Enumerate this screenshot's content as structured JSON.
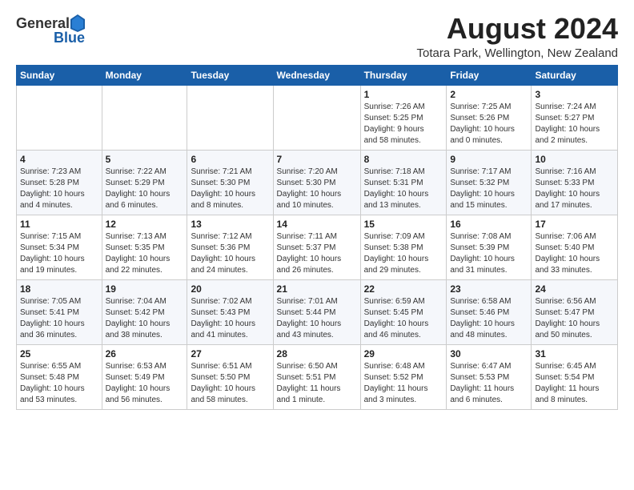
{
  "header": {
    "logo_general": "General",
    "logo_blue": "Blue",
    "month_title": "August 2024",
    "location": "Totara Park, Wellington, New Zealand"
  },
  "days_of_week": [
    "Sunday",
    "Monday",
    "Tuesday",
    "Wednesday",
    "Thursday",
    "Friday",
    "Saturday"
  ],
  "weeks": [
    [
      {
        "day": "",
        "info": ""
      },
      {
        "day": "",
        "info": ""
      },
      {
        "day": "",
        "info": ""
      },
      {
        "day": "",
        "info": ""
      },
      {
        "day": "1",
        "info": "Sunrise: 7:26 AM\nSunset: 5:25 PM\nDaylight: 9 hours\nand 58 minutes."
      },
      {
        "day": "2",
        "info": "Sunrise: 7:25 AM\nSunset: 5:26 PM\nDaylight: 10 hours\nand 0 minutes."
      },
      {
        "day": "3",
        "info": "Sunrise: 7:24 AM\nSunset: 5:27 PM\nDaylight: 10 hours\nand 2 minutes."
      }
    ],
    [
      {
        "day": "4",
        "info": "Sunrise: 7:23 AM\nSunset: 5:28 PM\nDaylight: 10 hours\nand 4 minutes."
      },
      {
        "day": "5",
        "info": "Sunrise: 7:22 AM\nSunset: 5:29 PM\nDaylight: 10 hours\nand 6 minutes."
      },
      {
        "day": "6",
        "info": "Sunrise: 7:21 AM\nSunset: 5:30 PM\nDaylight: 10 hours\nand 8 minutes."
      },
      {
        "day": "7",
        "info": "Sunrise: 7:20 AM\nSunset: 5:30 PM\nDaylight: 10 hours\nand 10 minutes."
      },
      {
        "day": "8",
        "info": "Sunrise: 7:18 AM\nSunset: 5:31 PM\nDaylight: 10 hours\nand 13 minutes."
      },
      {
        "day": "9",
        "info": "Sunrise: 7:17 AM\nSunset: 5:32 PM\nDaylight: 10 hours\nand 15 minutes."
      },
      {
        "day": "10",
        "info": "Sunrise: 7:16 AM\nSunset: 5:33 PM\nDaylight: 10 hours\nand 17 minutes."
      }
    ],
    [
      {
        "day": "11",
        "info": "Sunrise: 7:15 AM\nSunset: 5:34 PM\nDaylight: 10 hours\nand 19 minutes."
      },
      {
        "day": "12",
        "info": "Sunrise: 7:13 AM\nSunset: 5:35 PM\nDaylight: 10 hours\nand 22 minutes."
      },
      {
        "day": "13",
        "info": "Sunrise: 7:12 AM\nSunset: 5:36 PM\nDaylight: 10 hours\nand 24 minutes."
      },
      {
        "day": "14",
        "info": "Sunrise: 7:11 AM\nSunset: 5:37 PM\nDaylight: 10 hours\nand 26 minutes."
      },
      {
        "day": "15",
        "info": "Sunrise: 7:09 AM\nSunset: 5:38 PM\nDaylight: 10 hours\nand 29 minutes."
      },
      {
        "day": "16",
        "info": "Sunrise: 7:08 AM\nSunset: 5:39 PM\nDaylight: 10 hours\nand 31 minutes."
      },
      {
        "day": "17",
        "info": "Sunrise: 7:06 AM\nSunset: 5:40 PM\nDaylight: 10 hours\nand 33 minutes."
      }
    ],
    [
      {
        "day": "18",
        "info": "Sunrise: 7:05 AM\nSunset: 5:41 PM\nDaylight: 10 hours\nand 36 minutes."
      },
      {
        "day": "19",
        "info": "Sunrise: 7:04 AM\nSunset: 5:42 PM\nDaylight: 10 hours\nand 38 minutes."
      },
      {
        "day": "20",
        "info": "Sunrise: 7:02 AM\nSunset: 5:43 PM\nDaylight: 10 hours\nand 41 minutes."
      },
      {
        "day": "21",
        "info": "Sunrise: 7:01 AM\nSunset: 5:44 PM\nDaylight: 10 hours\nand 43 minutes."
      },
      {
        "day": "22",
        "info": "Sunrise: 6:59 AM\nSunset: 5:45 PM\nDaylight: 10 hours\nand 46 minutes."
      },
      {
        "day": "23",
        "info": "Sunrise: 6:58 AM\nSunset: 5:46 PM\nDaylight: 10 hours\nand 48 minutes."
      },
      {
        "day": "24",
        "info": "Sunrise: 6:56 AM\nSunset: 5:47 PM\nDaylight: 10 hours\nand 50 minutes."
      }
    ],
    [
      {
        "day": "25",
        "info": "Sunrise: 6:55 AM\nSunset: 5:48 PM\nDaylight: 10 hours\nand 53 minutes."
      },
      {
        "day": "26",
        "info": "Sunrise: 6:53 AM\nSunset: 5:49 PM\nDaylight: 10 hours\nand 56 minutes."
      },
      {
        "day": "27",
        "info": "Sunrise: 6:51 AM\nSunset: 5:50 PM\nDaylight: 10 hours\nand 58 minutes."
      },
      {
        "day": "28",
        "info": "Sunrise: 6:50 AM\nSunset: 5:51 PM\nDaylight: 11 hours\nand 1 minute."
      },
      {
        "day": "29",
        "info": "Sunrise: 6:48 AM\nSunset: 5:52 PM\nDaylight: 11 hours\nand 3 minutes."
      },
      {
        "day": "30",
        "info": "Sunrise: 6:47 AM\nSunset: 5:53 PM\nDaylight: 11 hours\nand 6 minutes."
      },
      {
        "day": "31",
        "info": "Sunrise: 6:45 AM\nSunset: 5:54 PM\nDaylight: 11 hours\nand 8 minutes."
      }
    ]
  ]
}
